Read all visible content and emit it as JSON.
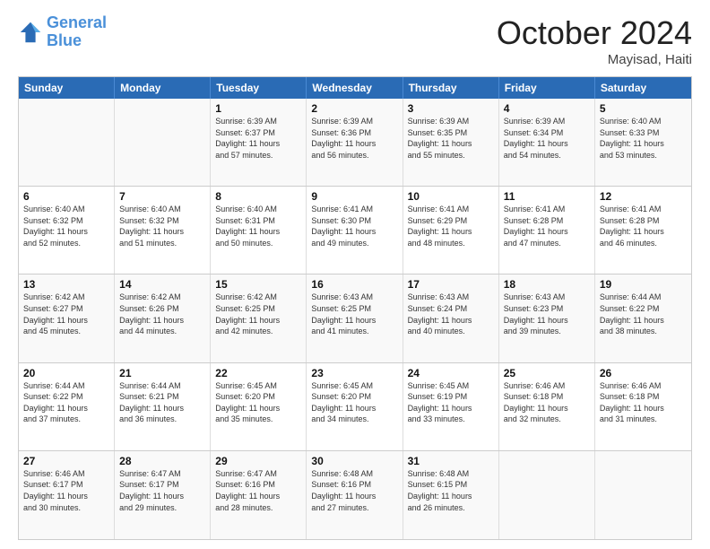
{
  "header": {
    "logo_line1": "General",
    "logo_line2": "Blue",
    "month": "October 2024",
    "location": "Mayisad, Haiti"
  },
  "days_of_week": [
    "Sunday",
    "Monday",
    "Tuesday",
    "Wednesday",
    "Thursday",
    "Friday",
    "Saturday"
  ],
  "weeks": [
    [
      {
        "day": "",
        "info": ""
      },
      {
        "day": "",
        "info": ""
      },
      {
        "day": "1",
        "info": "Sunrise: 6:39 AM\nSunset: 6:37 PM\nDaylight: 11 hours\nand 57 minutes."
      },
      {
        "day": "2",
        "info": "Sunrise: 6:39 AM\nSunset: 6:36 PM\nDaylight: 11 hours\nand 56 minutes."
      },
      {
        "day": "3",
        "info": "Sunrise: 6:39 AM\nSunset: 6:35 PM\nDaylight: 11 hours\nand 55 minutes."
      },
      {
        "day": "4",
        "info": "Sunrise: 6:39 AM\nSunset: 6:34 PM\nDaylight: 11 hours\nand 54 minutes."
      },
      {
        "day": "5",
        "info": "Sunrise: 6:40 AM\nSunset: 6:33 PM\nDaylight: 11 hours\nand 53 minutes."
      }
    ],
    [
      {
        "day": "6",
        "info": "Sunrise: 6:40 AM\nSunset: 6:32 PM\nDaylight: 11 hours\nand 52 minutes."
      },
      {
        "day": "7",
        "info": "Sunrise: 6:40 AM\nSunset: 6:32 PM\nDaylight: 11 hours\nand 51 minutes."
      },
      {
        "day": "8",
        "info": "Sunrise: 6:40 AM\nSunset: 6:31 PM\nDaylight: 11 hours\nand 50 minutes."
      },
      {
        "day": "9",
        "info": "Sunrise: 6:41 AM\nSunset: 6:30 PM\nDaylight: 11 hours\nand 49 minutes."
      },
      {
        "day": "10",
        "info": "Sunrise: 6:41 AM\nSunset: 6:29 PM\nDaylight: 11 hours\nand 48 minutes."
      },
      {
        "day": "11",
        "info": "Sunrise: 6:41 AM\nSunset: 6:28 PM\nDaylight: 11 hours\nand 47 minutes."
      },
      {
        "day": "12",
        "info": "Sunrise: 6:41 AM\nSunset: 6:28 PM\nDaylight: 11 hours\nand 46 minutes."
      }
    ],
    [
      {
        "day": "13",
        "info": "Sunrise: 6:42 AM\nSunset: 6:27 PM\nDaylight: 11 hours\nand 45 minutes."
      },
      {
        "day": "14",
        "info": "Sunrise: 6:42 AM\nSunset: 6:26 PM\nDaylight: 11 hours\nand 44 minutes."
      },
      {
        "day": "15",
        "info": "Sunrise: 6:42 AM\nSunset: 6:25 PM\nDaylight: 11 hours\nand 42 minutes."
      },
      {
        "day": "16",
        "info": "Sunrise: 6:43 AM\nSunset: 6:25 PM\nDaylight: 11 hours\nand 41 minutes."
      },
      {
        "day": "17",
        "info": "Sunrise: 6:43 AM\nSunset: 6:24 PM\nDaylight: 11 hours\nand 40 minutes."
      },
      {
        "day": "18",
        "info": "Sunrise: 6:43 AM\nSunset: 6:23 PM\nDaylight: 11 hours\nand 39 minutes."
      },
      {
        "day": "19",
        "info": "Sunrise: 6:44 AM\nSunset: 6:22 PM\nDaylight: 11 hours\nand 38 minutes."
      }
    ],
    [
      {
        "day": "20",
        "info": "Sunrise: 6:44 AM\nSunset: 6:22 PM\nDaylight: 11 hours\nand 37 minutes."
      },
      {
        "day": "21",
        "info": "Sunrise: 6:44 AM\nSunset: 6:21 PM\nDaylight: 11 hours\nand 36 minutes."
      },
      {
        "day": "22",
        "info": "Sunrise: 6:45 AM\nSunset: 6:20 PM\nDaylight: 11 hours\nand 35 minutes."
      },
      {
        "day": "23",
        "info": "Sunrise: 6:45 AM\nSunset: 6:20 PM\nDaylight: 11 hours\nand 34 minutes."
      },
      {
        "day": "24",
        "info": "Sunrise: 6:45 AM\nSunset: 6:19 PM\nDaylight: 11 hours\nand 33 minutes."
      },
      {
        "day": "25",
        "info": "Sunrise: 6:46 AM\nSunset: 6:18 PM\nDaylight: 11 hours\nand 32 minutes."
      },
      {
        "day": "26",
        "info": "Sunrise: 6:46 AM\nSunset: 6:18 PM\nDaylight: 11 hours\nand 31 minutes."
      }
    ],
    [
      {
        "day": "27",
        "info": "Sunrise: 6:46 AM\nSunset: 6:17 PM\nDaylight: 11 hours\nand 30 minutes."
      },
      {
        "day": "28",
        "info": "Sunrise: 6:47 AM\nSunset: 6:17 PM\nDaylight: 11 hours\nand 29 minutes."
      },
      {
        "day": "29",
        "info": "Sunrise: 6:47 AM\nSunset: 6:16 PM\nDaylight: 11 hours\nand 28 minutes."
      },
      {
        "day": "30",
        "info": "Sunrise: 6:48 AM\nSunset: 6:16 PM\nDaylight: 11 hours\nand 27 minutes."
      },
      {
        "day": "31",
        "info": "Sunrise: 6:48 AM\nSunset: 6:15 PM\nDaylight: 11 hours\nand 26 minutes."
      },
      {
        "day": "",
        "info": ""
      },
      {
        "day": "",
        "info": ""
      }
    ]
  ]
}
